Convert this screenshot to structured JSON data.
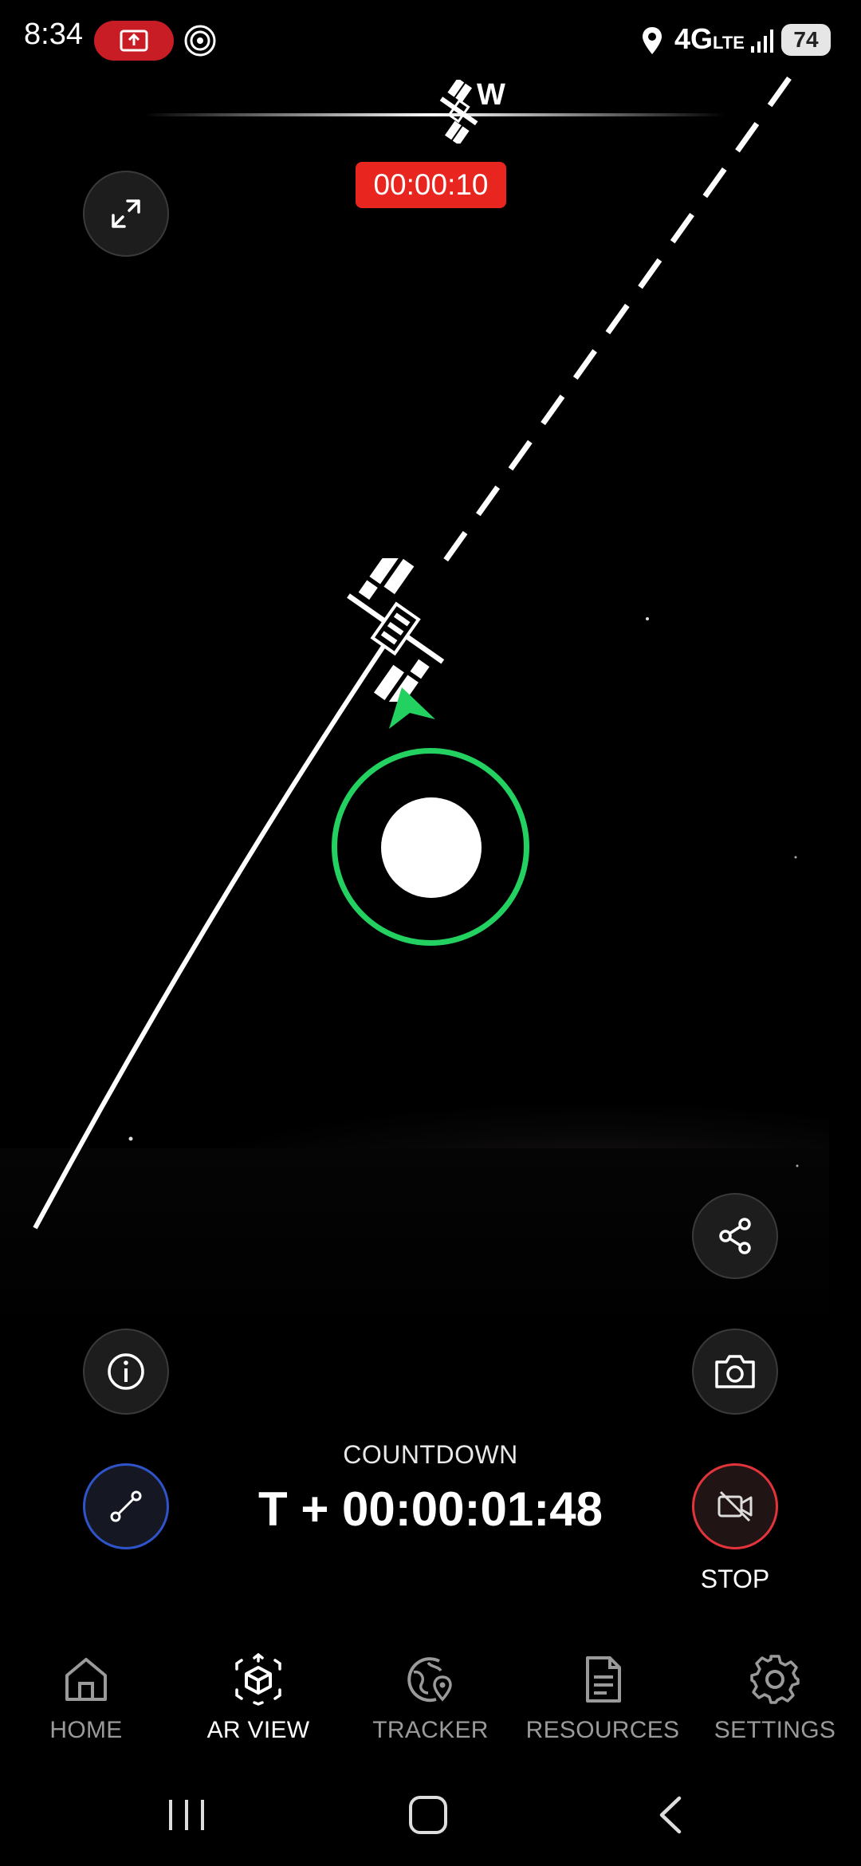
{
  "status_bar": {
    "time": "8:34",
    "network": "4G",
    "network_sub": "LTE",
    "battery": "74",
    "icons": [
      "screen-record-icon",
      "hotspot-icon",
      "location-icon",
      "signal-icon",
      "battery-icon"
    ]
  },
  "compass": {
    "heading": "W"
  },
  "recording_timer": "00:00:10",
  "countdown": {
    "label": "COUNTDOWN",
    "value": "T + 00:00:01:48"
  },
  "stop_label": "STOP",
  "controls": {
    "left": [
      "expand-icon",
      "info-icon",
      "path-icon"
    ],
    "right": [
      "share-icon",
      "camera-icon",
      "video-off-icon"
    ]
  },
  "colors": {
    "accent_green": "#23d160",
    "record_red": "#e8261f",
    "path_blue": "#2f54c9"
  },
  "nav": {
    "items": [
      {
        "label": "HOME",
        "icon": "home-icon",
        "active": false
      },
      {
        "label": "AR VIEW",
        "icon": "ar-cube-icon",
        "active": true
      },
      {
        "label": "TRACKER",
        "icon": "tracker-globe-icon",
        "active": false
      },
      {
        "label": "RESOURCES",
        "icon": "document-icon",
        "active": false
      },
      {
        "label": "SETTINGS",
        "icon": "gear-icon",
        "active": false
      }
    ]
  }
}
